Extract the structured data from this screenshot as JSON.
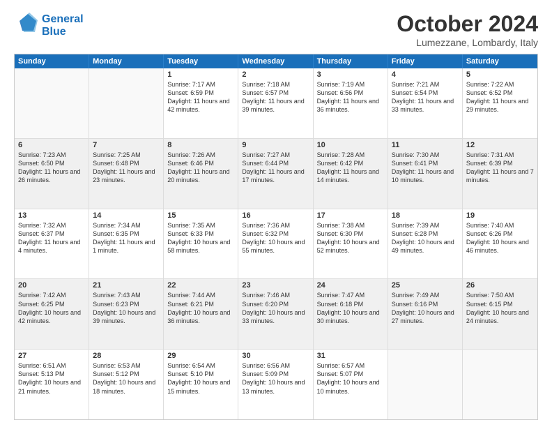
{
  "logo": {
    "line1": "General",
    "line2": "Blue"
  },
  "title": "October 2024",
  "location": "Lumezzane, Lombardy, Italy",
  "header_days": [
    "Sunday",
    "Monday",
    "Tuesday",
    "Wednesday",
    "Thursday",
    "Friday",
    "Saturday"
  ],
  "rows": [
    [
      {
        "day": "",
        "text": "",
        "empty": true
      },
      {
        "day": "",
        "text": "",
        "empty": true
      },
      {
        "day": "1",
        "text": "Sunrise: 7:17 AM\nSunset: 6:59 PM\nDaylight: 11 hours and 42 minutes."
      },
      {
        "day": "2",
        "text": "Sunrise: 7:18 AM\nSunset: 6:57 PM\nDaylight: 11 hours and 39 minutes."
      },
      {
        "day": "3",
        "text": "Sunrise: 7:19 AM\nSunset: 6:56 PM\nDaylight: 11 hours and 36 minutes."
      },
      {
        "day": "4",
        "text": "Sunrise: 7:21 AM\nSunset: 6:54 PM\nDaylight: 11 hours and 33 minutes."
      },
      {
        "day": "5",
        "text": "Sunrise: 7:22 AM\nSunset: 6:52 PM\nDaylight: 11 hours and 29 minutes."
      }
    ],
    [
      {
        "day": "6",
        "text": "Sunrise: 7:23 AM\nSunset: 6:50 PM\nDaylight: 11 hours and 26 minutes."
      },
      {
        "day": "7",
        "text": "Sunrise: 7:25 AM\nSunset: 6:48 PM\nDaylight: 11 hours and 23 minutes."
      },
      {
        "day": "8",
        "text": "Sunrise: 7:26 AM\nSunset: 6:46 PM\nDaylight: 11 hours and 20 minutes."
      },
      {
        "day": "9",
        "text": "Sunrise: 7:27 AM\nSunset: 6:44 PM\nDaylight: 11 hours and 17 minutes."
      },
      {
        "day": "10",
        "text": "Sunrise: 7:28 AM\nSunset: 6:42 PM\nDaylight: 11 hours and 14 minutes."
      },
      {
        "day": "11",
        "text": "Sunrise: 7:30 AM\nSunset: 6:41 PM\nDaylight: 11 hours and 10 minutes."
      },
      {
        "day": "12",
        "text": "Sunrise: 7:31 AM\nSunset: 6:39 PM\nDaylight: 11 hours and 7 minutes."
      }
    ],
    [
      {
        "day": "13",
        "text": "Sunrise: 7:32 AM\nSunset: 6:37 PM\nDaylight: 11 hours and 4 minutes."
      },
      {
        "day": "14",
        "text": "Sunrise: 7:34 AM\nSunset: 6:35 PM\nDaylight: 11 hours and 1 minute."
      },
      {
        "day": "15",
        "text": "Sunrise: 7:35 AM\nSunset: 6:33 PM\nDaylight: 10 hours and 58 minutes."
      },
      {
        "day": "16",
        "text": "Sunrise: 7:36 AM\nSunset: 6:32 PM\nDaylight: 10 hours and 55 minutes."
      },
      {
        "day": "17",
        "text": "Sunrise: 7:38 AM\nSunset: 6:30 PM\nDaylight: 10 hours and 52 minutes."
      },
      {
        "day": "18",
        "text": "Sunrise: 7:39 AM\nSunset: 6:28 PM\nDaylight: 10 hours and 49 minutes."
      },
      {
        "day": "19",
        "text": "Sunrise: 7:40 AM\nSunset: 6:26 PM\nDaylight: 10 hours and 46 minutes."
      }
    ],
    [
      {
        "day": "20",
        "text": "Sunrise: 7:42 AM\nSunset: 6:25 PM\nDaylight: 10 hours and 42 minutes."
      },
      {
        "day": "21",
        "text": "Sunrise: 7:43 AM\nSunset: 6:23 PM\nDaylight: 10 hours and 39 minutes."
      },
      {
        "day": "22",
        "text": "Sunrise: 7:44 AM\nSunset: 6:21 PM\nDaylight: 10 hours and 36 minutes."
      },
      {
        "day": "23",
        "text": "Sunrise: 7:46 AM\nSunset: 6:20 PM\nDaylight: 10 hours and 33 minutes."
      },
      {
        "day": "24",
        "text": "Sunrise: 7:47 AM\nSunset: 6:18 PM\nDaylight: 10 hours and 30 minutes."
      },
      {
        "day": "25",
        "text": "Sunrise: 7:49 AM\nSunset: 6:16 PM\nDaylight: 10 hours and 27 minutes."
      },
      {
        "day": "26",
        "text": "Sunrise: 7:50 AM\nSunset: 6:15 PM\nDaylight: 10 hours and 24 minutes."
      }
    ],
    [
      {
        "day": "27",
        "text": "Sunrise: 6:51 AM\nSunset: 5:13 PM\nDaylight: 10 hours and 21 minutes."
      },
      {
        "day": "28",
        "text": "Sunrise: 6:53 AM\nSunset: 5:12 PM\nDaylight: 10 hours and 18 minutes."
      },
      {
        "day": "29",
        "text": "Sunrise: 6:54 AM\nSunset: 5:10 PM\nDaylight: 10 hours and 15 minutes."
      },
      {
        "day": "30",
        "text": "Sunrise: 6:56 AM\nSunset: 5:09 PM\nDaylight: 10 hours and 13 minutes."
      },
      {
        "day": "31",
        "text": "Sunrise: 6:57 AM\nSunset: 5:07 PM\nDaylight: 10 hours and 10 minutes."
      },
      {
        "day": "",
        "text": "",
        "empty": true
      },
      {
        "day": "",
        "text": "",
        "empty": true
      }
    ]
  ]
}
